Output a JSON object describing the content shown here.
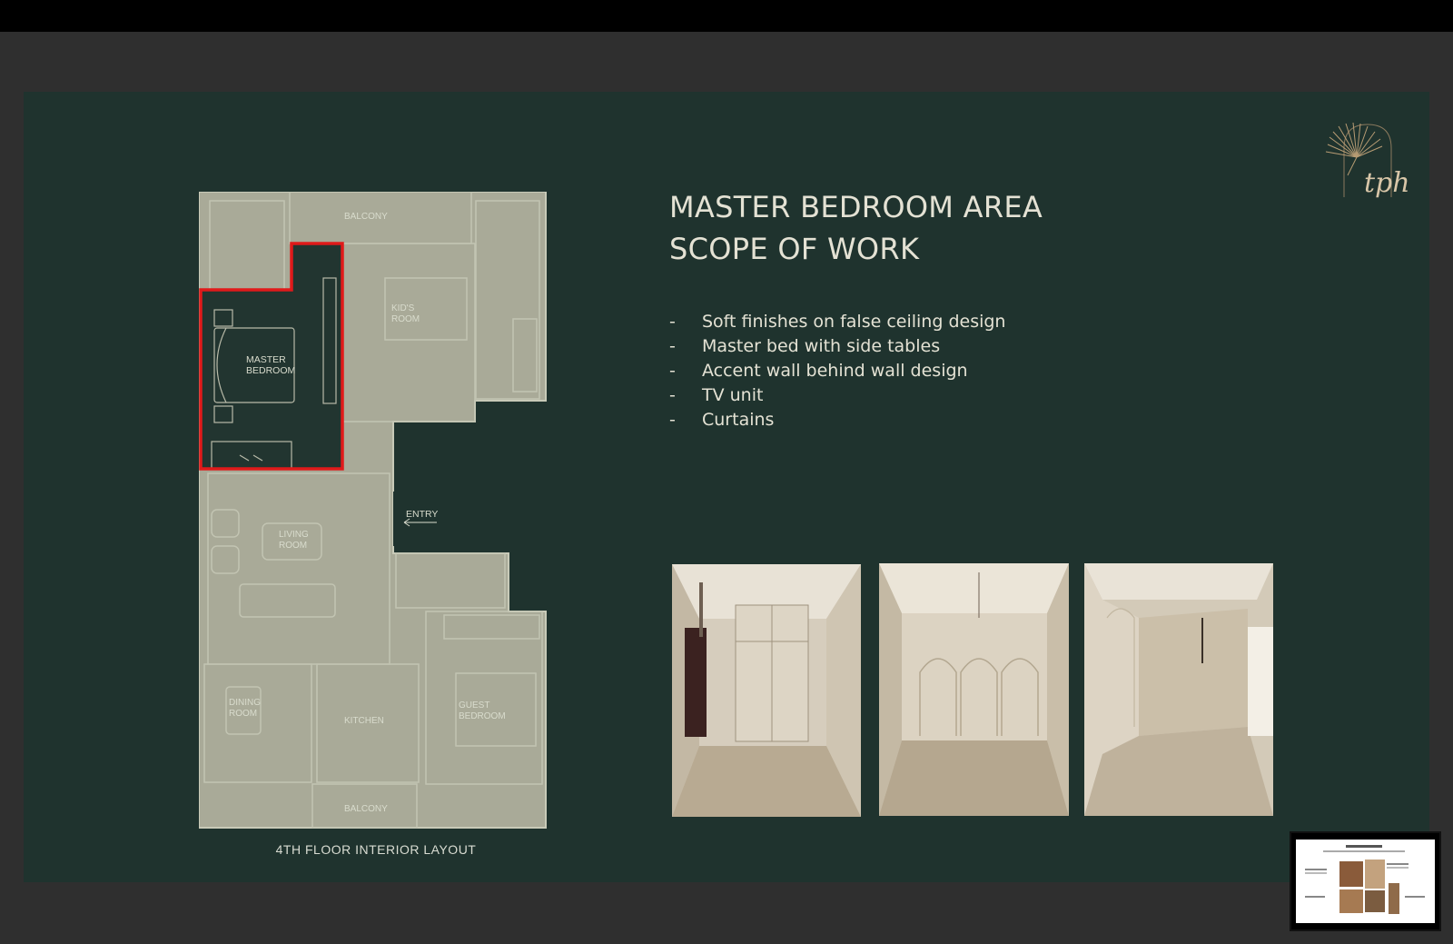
{
  "slide": {
    "heading_line1": "MASTER BEDROOM AREA",
    "heading_line2": "SCOPE OF WORK",
    "bullets": [
      "Soft finishes on false ceiling design",
      "Master bed with side tables",
      "Accent wall behind wall design",
      "TV unit",
      "Curtains"
    ],
    "bullet_marker": "-",
    "logo_text": "tph",
    "plan_caption": "4TH FLOOR INTERIOR LAYOUT",
    "plan_labels": {
      "balcony_top": "BALCONY",
      "kids_room": [
        "KID'S",
        "ROOM"
      ],
      "master_bedroom": [
        "MASTER",
        "BEDROOM"
      ],
      "entry": "ENTRY",
      "living_room": [
        "LIVING",
        "ROOM"
      ],
      "dining_room": [
        "DINING",
        "ROOM"
      ],
      "kitchen": "KITCHEN",
      "guest_bedroom": [
        "GUEST",
        "BEDROOM"
      ],
      "balcony_bottom": "BALCONY"
    },
    "highlight_color": "#e01a1a",
    "background_color": "#1f332e"
  }
}
